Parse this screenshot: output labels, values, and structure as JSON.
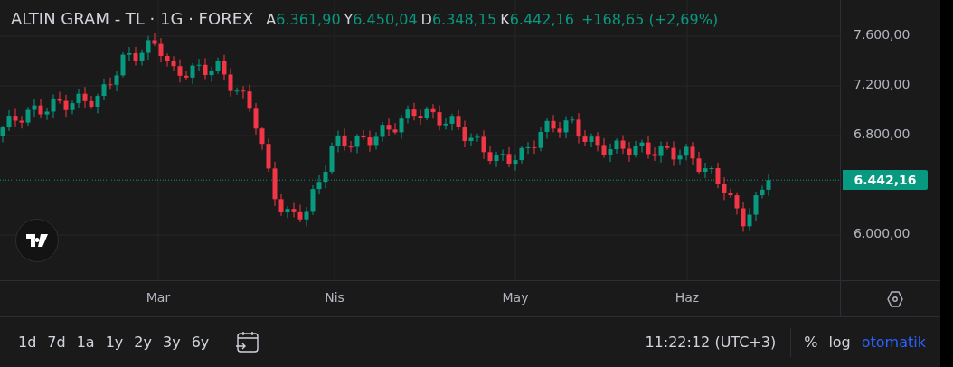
{
  "legend": {
    "title": "ALTIN GRAM - TL · 1G · FOREX",
    "values": [
      {
        "label": "A",
        "value": "6.361,90"
      },
      {
        "label": "Y",
        "value": "6.450,04"
      },
      {
        "label": "D",
        "value": "6.348,15"
      },
      {
        "label": "K",
        "value": "6.442,16"
      }
    ],
    "change": "+168,65 (+2,69%)"
  },
  "price_axis": [
    "7.600,00",
    "7.200,00",
    "6.800,00",
    "6.000,00"
  ],
  "last_price": "6.442,16",
  "time_axis": [
    "Mar",
    "Nis",
    "May",
    "Haz"
  ],
  "bottom_bar": {
    "ranges": [
      "1d",
      "7d",
      "1a",
      "1y",
      "2y",
      "3y",
      "6y"
    ],
    "time": "11:22:12 (UTC+3)",
    "toggles": [
      {
        "label": "%",
        "selected": false
      },
      {
        "label": "log",
        "selected": false
      },
      {
        "label": "otomatik",
        "selected": true
      }
    ]
  }
}
